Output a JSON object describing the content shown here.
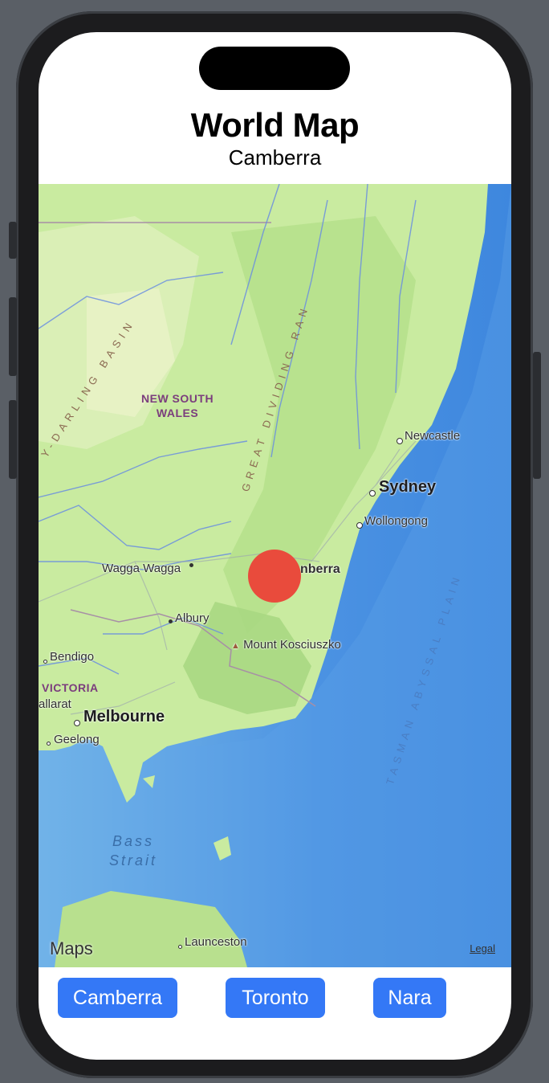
{
  "header": {
    "title": "World Map",
    "subtitle": "Camberra"
  },
  "map": {
    "labels": {
      "newcastle": "Newcastle",
      "sydney": "Sydney",
      "wollongong": "Wollongong",
      "canberra": "nberra",
      "wagga": "Wagga Wagga",
      "albury": "Albury",
      "kosciuszko": "Mount Kosciuszko",
      "bendigo": "Bendigo",
      "ballarat": "allarat",
      "melbourne": "Melbourne",
      "geelong": "Geelong",
      "launceston": "Launceston",
      "nsw": "NEW SOUTH\nWALES",
      "victoria": "VICTORIA",
      "bass_strait": "Bass\nStrait",
      "great_dividing": "GREAT DIVIDING RAN",
      "darling_basin": "Y-DARLING BASIN",
      "tasman": "TASMAN ABYSSAL PLAIN"
    },
    "attribution": {
      "logo": "Maps",
      "legal": "Legal"
    },
    "marker": {
      "label": "Camberra",
      "color": "#e94b3c"
    }
  },
  "buttons": [
    {
      "label": "Camberra"
    },
    {
      "label": "Toronto"
    },
    {
      "label": "Nara"
    }
  ],
  "colors": {
    "accent": "#3478f6",
    "land": "#c9eba0",
    "ocean": "#4f93e3"
  }
}
